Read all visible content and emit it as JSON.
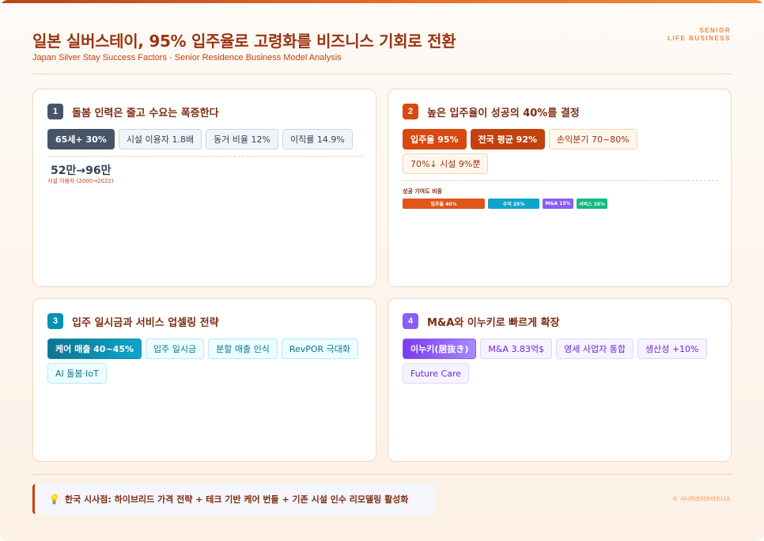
{
  "header": {
    "title": "일본 실버스테이, 95% 입주율로 고령화를 비즈니스 기회로 전환",
    "subtitle": "Japan Silver Stay Success Factors · Senior Residence Business Model Analysis",
    "tag_line1": "SENIOR",
    "tag_line2": "LIFE BUSINESS"
  },
  "cards": [
    {
      "number": "1",
      "title": "돌봄 인력은 줄고 수요는 폭증한다",
      "chips": [
        "65세+ 30%",
        "시설 이용자 1.8배",
        "동거 비율 12%",
        "이직률 14.9%"
      ],
      "stat": "52만→96만",
      "stat_caption": "시설 이용자 (2000→2022)"
    },
    {
      "number": "2",
      "title": "높은 입주율이 성공의 40%를 결정",
      "chips": [
        "입주율 95%",
        "전국 평균 92%",
        "손익분기 70~80%",
        "70%↓ 시설 9%뿐"
      ],
      "bar_title": "성공 기여도 비중",
      "bars": [
        {
          "label": "입주율 40%",
          "value": 40,
          "color": "#e0561a"
        },
        {
          "label": "수익 25%",
          "value": 25,
          "color": "#0ea5c9"
        },
        {
          "label": "M&A 15%",
          "value": 15,
          "color": "#8b5cf6"
        },
        {
          "label": "서비스 15%",
          "value": 15,
          "color": "#10b981"
        }
      ]
    },
    {
      "number": "3",
      "title": "입주 일시금과 서비스 업셀링 전략",
      "chips": [
        "케어 매출 40~45%",
        "입주 일시금",
        "분할 매출 인식",
        "RevPOR 극대화",
        "AI 돌봄·IoT"
      ]
    },
    {
      "number": "4",
      "title": "M&A와 이누키로 빠르게 확장",
      "chips": [
        "이누키(居抜き)",
        "M&A 3.83억$",
        "영세 사업자 통합",
        "생산성 +10%",
        "Future Care"
      ]
    }
  ],
  "footer": {
    "callout_icon": "lightbulb-icon",
    "callout": "한국 시사점: 하이브리드 가격 전략 + 테크 기반 케어 번들 + 기존 시설 인수 리모델링 활성화",
    "copyright": "© 시니어라이프비즈니스"
  },
  "colors": {
    "accent": "#c2410c",
    "title": "#9a3412",
    "slate": "#475569",
    "teal": "#0891b2",
    "violet": "#8b5cf6"
  }
}
